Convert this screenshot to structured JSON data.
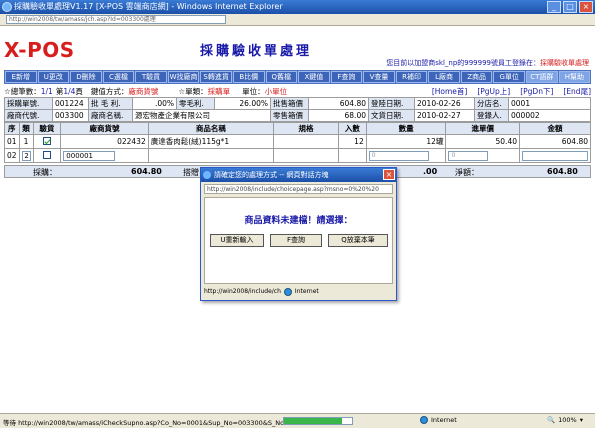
{
  "window": {
    "title": "採購驗收單處理V1.17 [X-POS 雲端商店網] - Windows Internet Explorer",
    "address": "http://win2008/tw/amass/jch.asp?Id=003300處理"
  },
  "header": {
    "logo": "X-POS",
    "page_title": "採購驗收單處理",
    "notice_prefix": "您目前以加盟商skl_np的999999號員工登錄在：",
    "notice_module": "採購驗收單處理"
  },
  "toolbar": {
    "buttons": [
      "E新增",
      "U更改",
      "D刪除",
      "C選檔",
      "T驗貨",
      "W找廠商",
      "S轉進貨",
      "B比價",
      "Q舊檔",
      "X鍵值",
      "F查詢",
      "V查量",
      "R補印",
      "L廠商",
      "Z商品",
      "G單位",
      "CT語群",
      "H幫助"
    ]
  },
  "info": {
    "total_label": "☆總筆數：",
    "total_value": "1/1",
    "page_label": "第",
    "page_value": "1/4",
    "page_suffix": "頁",
    "key_label": "鍵值方式：",
    "key_value": "廠商貨號",
    "doc_type_label": "☆單類：",
    "doc_type_value": "採購單",
    "unit_label": "單位：",
    "unit_value": "小單位",
    "nav": [
      "[Home首]",
      "[PgUp上]",
      "[PgDn下]",
      "[End尾]"
    ]
  },
  "form": {
    "purchase_no_label": "採購單號.",
    "purchase_no": "001224",
    "gross_margin_label": "批 毛 利.",
    "gross_margin": ".00%",
    "retail_margin_label": "零毛利.",
    "retail_margin": "26.00%",
    "batch_box_label": "批售箱價",
    "batch_box_price": "604.80",
    "reg_date_label": "登陸日期.",
    "reg_date": "2010-02-26",
    "branch_label": "分店名.",
    "branch": "0001",
    "vendor_code_label": "廠商代號.",
    "vendor_code": "003300",
    "vendor_name_label": "廠商名稱.",
    "vendor_name": "源宏物產企業有限公司",
    "retail_box_label": "零售箱價",
    "retail_box_price": "68.00",
    "doc_date_label": "文貨日期.",
    "doc_date": "2010-02-27",
    "registrar_label": "登錄人.",
    "registrar": "000002"
  },
  "detail": {
    "headers": [
      "序",
      "類",
      "驗貨",
      "廠商貨號",
      "商品名稱",
      "規格",
      "入數",
      "數量",
      "進單價",
      "金額"
    ],
    "rows": [
      {
        "seq": "01",
        "kind": "1",
        "checked": true,
        "vendor_sku": "022432",
        "name": "廣達香肉鬆(絨)115g*1",
        "spec": "",
        "pack": "12",
        "qty": "12罐",
        "unit_price": "50.40",
        "amount": "604.80"
      },
      {
        "seq": "02",
        "kind": "2",
        "checked": false,
        "vendor_sku": "000001",
        "name": "",
        "spec": "",
        "pack": "",
        "qty": "0",
        "unit_price": "0",
        "amount": ""
      }
    ]
  },
  "totals": {
    "purchase_label": "採購：",
    "purchase_value": "604.80",
    "discount_label": "搭贈",
    "mid_value": ".00",
    "net_label": "淨額：",
    "net_value": "604.80"
  },
  "popup": {
    "title": "請確定您的處理方式 -- 網頁對話方塊",
    "address": "http://win2008/include/choicepage.asp?msno=0%20%20",
    "message": "商品資料未建檔！請選擇：",
    "btn_reenter": "U重新輸入",
    "btn_query": "F查詢",
    "btn_basic": "Q放棄本筆",
    "status_url": "http://win2008/include/ch",
    "status_zone": "Internet"
  },
  "statusbar": {
    "text": "等待 http://win2008/tw/amass/iCheckSupno.asp?Co_No=0001&Sup_No=003300&S_No=0000",
    "progress": 0.85,
    "zone": "Internet",
    "zoom": "100%"
  },
  "colors": {
    "logo_red": "#d81d1d",
    "title_blue": "#1a1aa8",
    "toolbar_blue": "#4a72c0",
    "label_bg": "#dfe6f3"
  }
}
